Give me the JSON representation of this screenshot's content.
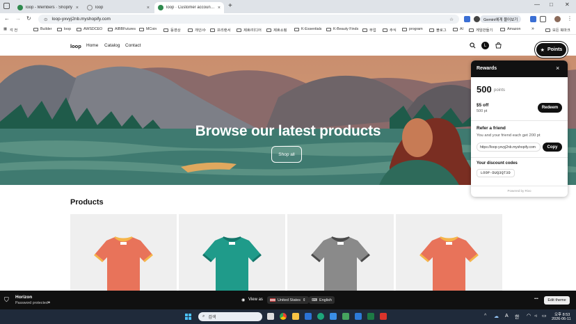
{
  "browser": {
    "tabs": [
      {
        "title": "loop - Members · Shopify",
        "close": "×",
        "color": "#2f8a4e"
      },
      {
        "title": "loop",
        "close": "×",
        "color": "#888888"
      },
      {
        "title": "loop · Customer accounts · Sh",
        "close": "×",
        "color": "#2f8a4e"
      }
    ],
    "new_tab": "+",
    "url": "loop-yxvyj2nb.myshopify.com",
    "gemini_label": "Gemini에게 물어보기",
    "bookmarks": [
      {
        "label": "Builder"
      },
      {
        "label": "loop"
      },
      {
        "label": "AWSDCEO"
      },
      {
        "label": "AIBBFutures"
      },
      {
        "label": "MCoin"
      },
      {
        "label": "동영상"
      },
      {
        "label": "개인/수"
      },
      {
        "label": "프리랜서"
      },
      {
        "label": "제휴/미디어"
      },
      {
        "label": "제휴쇼핑"
      },
      {
        "label": "K-Essentials"
      },
      {
        "label": "K-Beauty Finds"
      },
      {
        "label": "부업"
      },
      {
        "label": "주식"
      },
      {
        "label": "program"
      },
      {
        "label": "블로그"
      },
      {
        "label": "AI"
      },
      {
        "label": "게임만들기"
      },
      {
        "label": "Amazon"
      }
    ],
    "bookmarks_more": "»",
    "all_bookmarks": "모든 북마크"
  },
  "store": {
    "logo": "loop",
    "nav": [
      "Home",
      "Catalog",
      "Contact"
    ],
    "account_initial": "L",
    "hero_title": "Browse our latest products",
    "hero_button": "Shop all",
    "products_title": "Products",
    "products": [
      {
        "color": "#e8735a",
        "collar": "#f5b54a"
      },
      {
        "color": "#1f9b8a",
        "collar": "#14766a"
      },
      {
        "color": "#8a8a8a",
        "collar": "#4a4a4a"
      },
      {
        "color": "#e8735a",
        "collar": "#f5b54a"
      }
    ]
  },
  "rewards": {
    "launcher_label": "Points",
    "title": "Rewards",
    "close": "×",
    "points": "500",
    "points_unit": "points",
    "offer_title": "$5 off",
    "offer_cost": "500 pt",
    "redeem_label": "Redeem",
    "refer_title": "Refer a friend",
    "refer_desc": "You and your friend each get 200 pt",
    "referral_url": "https://loop-yxvyj2nb.myshopify.com",
    "copy_label": "Copy",
    "codes_title": "Your discount codes",
    "code": "LOOP-DUQ3QT3D",
    "powered_by": "Powered by Rivo"
  },
  "admin_bar": {
    "theme_name": "Horizon",
    "status": "Password protected",
    "view_as": "View as",
    "country": "United States",
    "language": "English",
    "more": "•••",
    "edit_theme": "Edit theme"
  },
  "taskbar": {
    "search_placeholder": "검색",
    "lang": "A",
    "ime": "한",
    "time": "오후 8:53",
    "date": "2026-06-11"
  },
  "colors": {
    "hero_sky": "#7a8fa1",
    "hero_water": "#3f7a70",
    "accent": "#111111"
  }
}
